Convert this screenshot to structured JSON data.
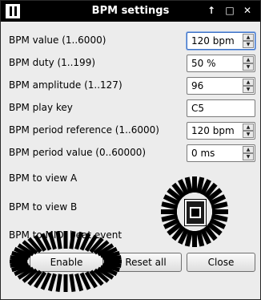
{
  "window": {
    "title": "BPM settings",
    "controls": {
      "shade": "↑",
      "maximize": "□",
      "close": "✕"
    }
  },
  "fields": [
    {
      "label": "BPM value (1..6000)",
      "value": "120 bpm"
    },
    {
      "label": "BPM duty (1..199)",
      "value": "50 %"
    },
    {
      "label": "BPM amplitude (1..127)",
      "value": "96"
    },
    {
      "label": "BPM play key",
      "value": "C5"
    },
    {
      "label": "BPM period reference (1..6000)",
      "value": "120 bpm"
    },
    {
      "label": "BPM period value (0..60000)",
      "value": "0 ms"
    }
  ],
  "checks": [
    {
      "label": "BPM to view A"
    },
    {
      "label": "BPM to view B"
    },
    {
      "label": "BPM to MIDI beat event"
    }
  ],
  "buttons": {
    "enable": "Enable",
    "reset_all": "Reset all",
    "close": "Close"
  },
  "colors": {
    "titlebar": "#000000",
    "window_bg": "#ececec",
    "focus": "#3a6fc4"
  }
}
